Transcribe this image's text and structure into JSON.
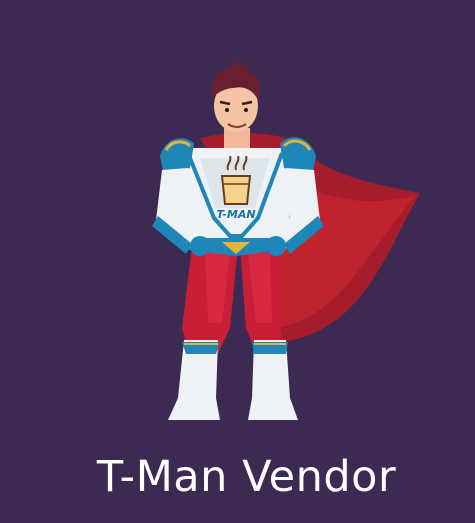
{
  "app": {
    "title": "T-Man Vendor"
  },
  "mascot": {
    "icon": "superhero-mascot-icon",
    "badge_text": "T-MAN",
    "badge_icon": "tea-glass-icon"
  },
  "colors": {
    "background": "#3c2a52",
    "cape": "#b01e2a",
    "suit_white": "#eef2f5",
    "suit_blue": "#1f86b8",
    "suit_red": "#c81e36",
    "gold": "#e5b43c",
    "hair": "#6a1f2e"
  }
}
